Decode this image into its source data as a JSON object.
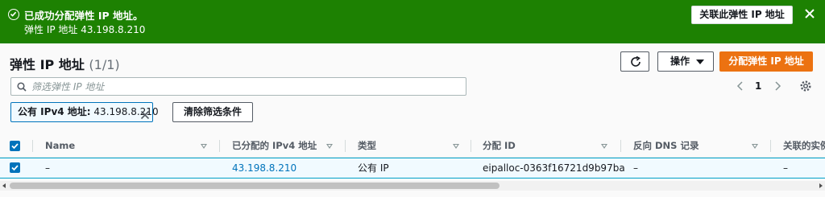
{
  "flash": {
    "title": "已成功分配弹性 IP 地址。",
    "message": "弹性 IP 地址 43.198.8.210",
    "action_label": "关联此弹性 IP 地址",
    "color": "#1d8102"
  },
  "header": {
    "title": "弹性 IP 地址",
    "count": "(1/1)",
    "actions_label": "操作",
    "allocate_label": "分配弹性 IP 地址",
    "accent_color": "#ec7211"
  },
  "search": {
    "placeholder": "筛选弹性 IP 地址",
    "value": ""
  },
  "pagination": {
    "page": "1"
  },
  "filter_token": {
    "key": "公有 IPv4 地址:",
    "value": "43.198.8.210"
  },
  "clear_filters_label": "清除筛选条件",
  "table": {
    "columns": [
      "Name",
      "已分配的 IPv4 地址",
      "类型",
      "分配 ID",
      "反向 DNS 记录",
      "关联的实例"
    ],
    "rows": [
      {
        "selected": true,
        "name": "–",
        "ipv4": "43.198.8.210",
        "type": "公有 IP",
        "allocation_id": "eipalloc-0363f16721d9b97ba",
        "reverse_dns": "–",
        "instance": "–"
      }
    ]
  },
  "icons": {
    "success": "check-circle-icon",
    "close": "close-icon",
    "refresh": "refresh-icon",
    "search": "search-icon",
    "settings": "gear-icon"
  }
}
